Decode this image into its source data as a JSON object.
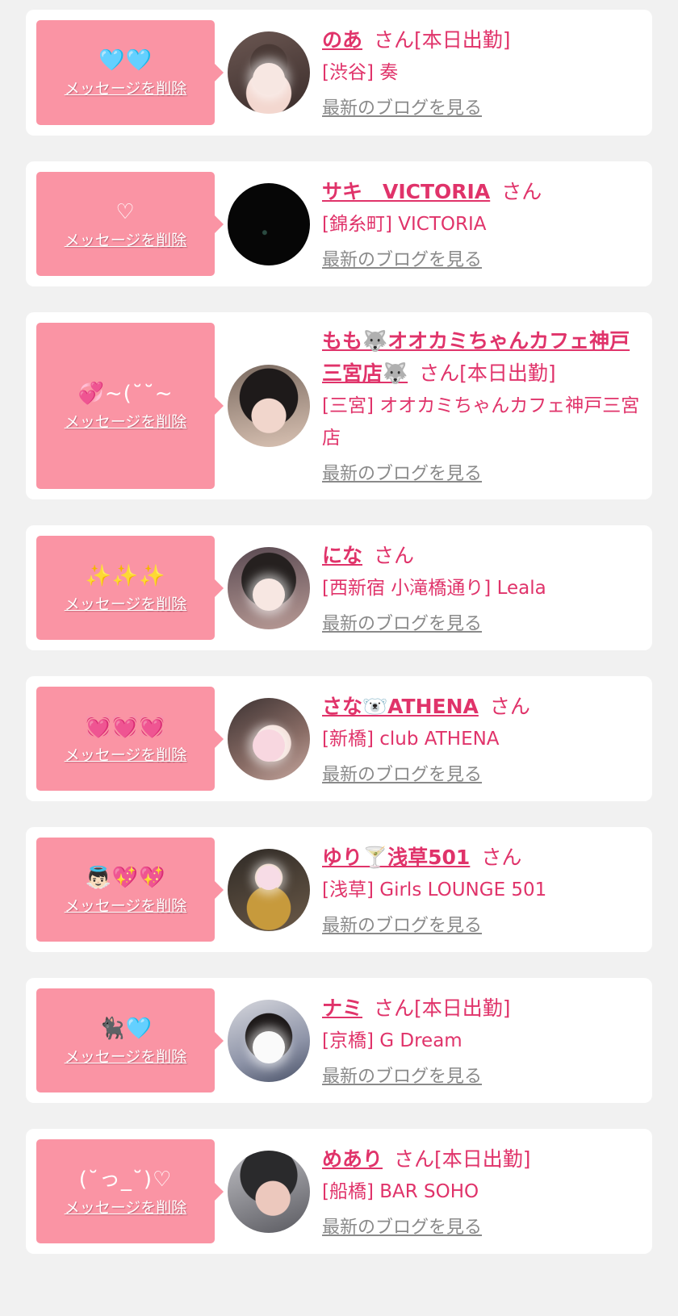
{
  "delete_label": "メッセージを削除",
  "blog_label": "最新のブログを見る",
  "colors": {
    "accent": "#e0336a",
    "bubble": "#fa94a4",
    "card": "#ffffff",
    "background": "#f1f1f1",
    "link_gray": "#8a8a8a"
  },
  "entries": [
    {
      "message": "🩵🩵",
      "name": "のあ",
      "suffix": "さん[本日出勤]",
      "shop": "[渋谷] 奏",
      "avatar": "avatar-photo"
    },
    {
      "message": "♡",
      "name": "サキ　VICTORIA",
      "suffix": "さん",
      "shop": "[錦糸町] VICTORIA",
      "avatar": "avatar-photo"
    },
    {
      "message": "💞~(˘˘~",
      "name": "もも🐺オオカミちゃんカフェ神戸三宮店🐺",
      "suffix": "さん[本日出勤]",
      "shop": "[三宮] オオカミちゃんカフェ神戸三宮店",
      "avatar": "avatar-photo"
    },
    {
      "message": "✨✨✨",
      "name": "にな",
      "suffix": "さん",
      "shop": "[西新宿 小滝橋通り] Leala",
      "avatar": "avatar-photo"
    },
    {
      "message": "💓💓💓",
      "name": "さな🐻‍❄️ATHENA",
      "suffix": "さん",
      "shop": "[新橋] club ATHENA",
      "avatar": "avatar-photo"
    },
    {
      "message": "👼🏻💖💖",
      "name": "ゆり🍸浅草501",
      "suffix": "さん",
      "shop": "[浅草] Girls LOUNGE 501",
      "avatar": "avatar-photo"
    },
    {
      "message": "🐈‍⬛🩵",
      "name": "ナミ",
      "suffix": "さん[本日出勤]",
      "shop": "[京橋] G Dream",
      "avatar": "avatar-photo"
    },
    {
      "message": "(˘っ_˘)♡",
      "name": "めあり",
      "suffix": "さん[本日出勤]",
      "shop": "[船橋] BAR SOHO",
      "avatar": "avatar-photo"
    }
  ]
}
